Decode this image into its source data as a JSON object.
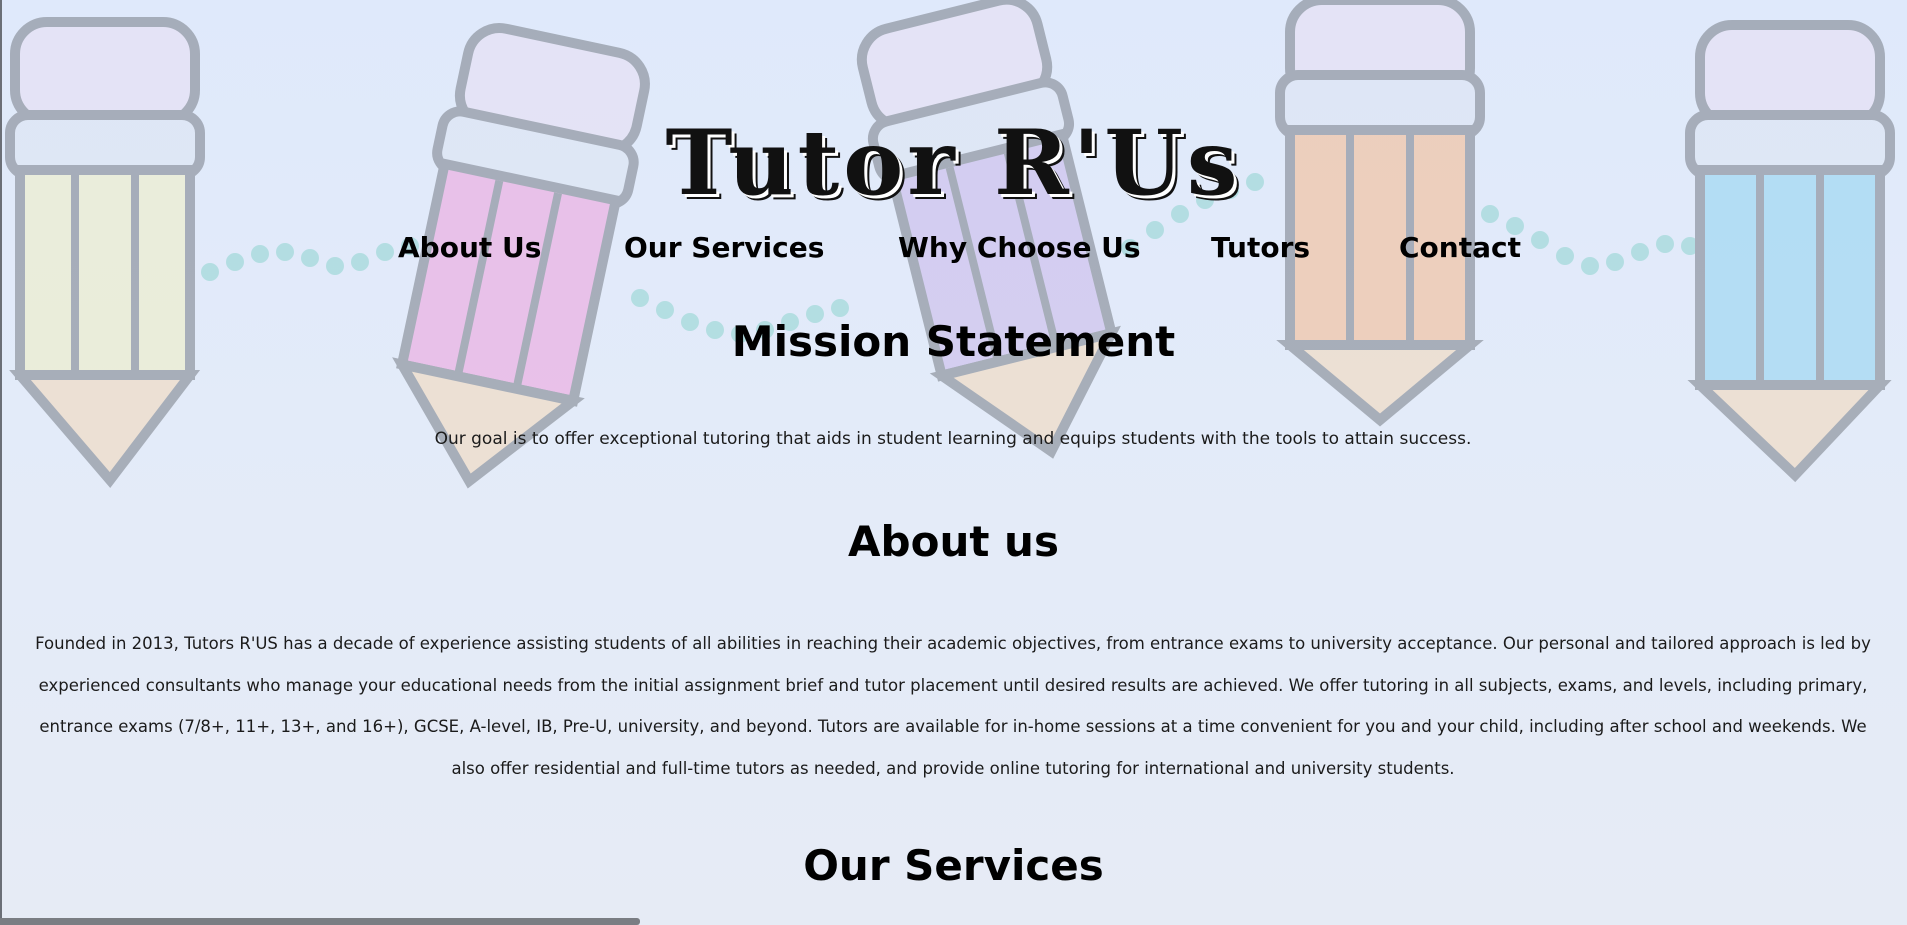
{
  "site": {
    "title": "Tutor R'Us"
  },
  "nav": {
    "items": [
      {
        "label": "About Us"
      },
      {
        "label": "Our Services"
      },
      {
        "label": "Why Choose Us"
      },
      {
        "label": "Tutors"
      },
      {
        "label": "Contact"
      }
    ]
  },
  "mission": {
    "heading": "Mission Statement",
    "text": "Our goal is to offer exceptional tutoring that aids in student learning and equips students with the tools to attain success."
  },
  "about": {
    "heading": "About us",
    "text": "Founded in 2013, Tutors R'US has a decade of experience assisting students of all abilities in reaching their academic objectives, from entrance exams to university acceptance. Our personal and tailored approach is led by experienced consultants who manage your educational needs from the initial assignment brief and tutor placement until desired results are achieved. We offer tutoring in all subjects, exams, and levels, including primary, entrance exams (7/8+, 11+, 13+, and 16+), GCSE, A-level, IB, Pre-U, university, and beyond. Tutors are available for in-home sessions at a time convenient for you and your child, including after school and weekends. We also offer residential and full-time tutors as needed, and provide online tutoring for international and university students."
  },
  "services": {
    "heading": "Our Services"
  },
  "colors": {
    "background": "#e1eafa",
    "pencil_yellow": "#f2f0c2",
    "pencil_pink": "#eea0dc",
    "pencil_purple": "#c9b7ea",
    "pencil_orange": "#f7b98d",
    "pencil_blue": "#8fd3f0",
    "dots_teal": "#8ed4cf"
  },
  "decor": {
    "icons": [
      "pencil-icon",
      "pencil-icon",
      "pencil-icon",
      "pencil-icon",
      "pencil-icon"
    ]
  }
}
